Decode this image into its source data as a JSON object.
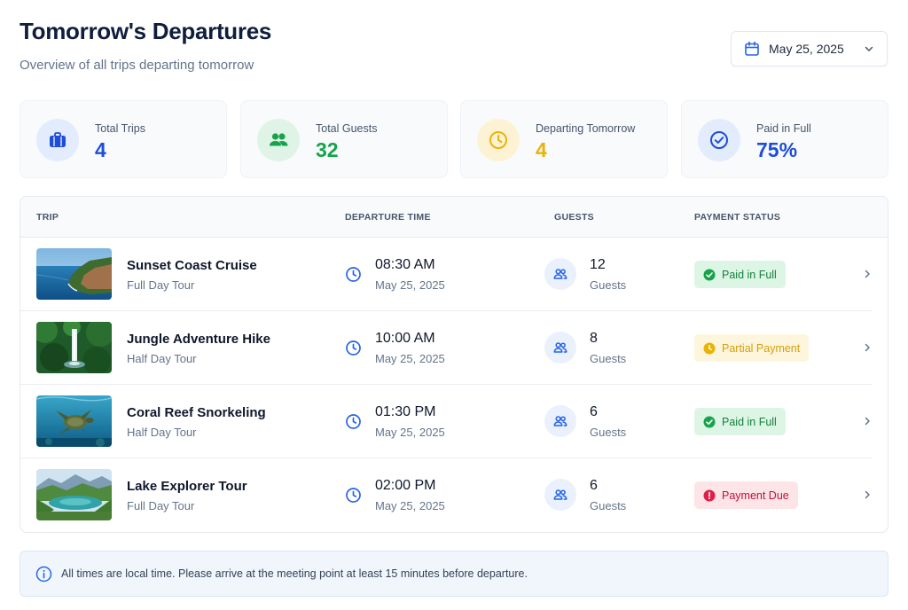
{
  "header": {
    "title": "Tomorrow's Departures",
    "subtitle": "Overview of all trips departing tomorrow",
    "date_picker": {
      "value": "May 25, 2025",
      "icon": "calendar-icon"
    }
  },
  "stats": [
    {
      "label": "Total Trips",
      "value": "4",
      "icon": "suitcase-icon",
      "color": "#1d4ed8",
      "bg": "#e3ecfc"
    },
    {
      "label": "Total Guests",
      "value": "32",
      "icon": "users-icon",
      "color": "#16a34a",
      "bg": "#dff3e6"
    },
    {
      "label": "Departing Tomorrow",
      "value": "4",
      "icon": "clock-icon",
      "color": "#eab308",
      "bg": "#fdf3d4"
    },
    {
      "label": "Paid in Full",
      "value": "75%",
      "icon": "check-circle-icon",
      "color": "#1d4ed8",
      "bg": "#e3ecfc"
    }
  ],
  "table": {
    "headers": {
      "trip": "TRIP",
      "departure": "DEPARTURE TIME",
      "guests": "GUESTS",
      "payment": "PAYMENT STATUS"
    },
    "rows": [
      {
        "name": "Sunset Coast Cruise",
        "type": "Full Day Tour",
        "time": "08:30 AM",
        "date": "May 25, 2025",
        "guests": "12",
        "guests_label": "Guests",
        "status": "Paid in Full",
        "status_kind": "paid",
        "image": "coast-photo"
      },
      {
        "name": "Jungle Adventure Hike",
        "type": "Half Day Tour",
        "time": "10:00 AM",
        "date": "May 25, 2025",
        "guests": "8",
        "guests_label": "Guests",
        "status": "Partial Payment",
        "status_kind": "partial",
        "image": "jungle-waterfall-photo"
      },
      {
        "name": "Coral Reef Snorkeling",
        "type": "Half Day Tour",
        "time": "01:30 PM",
        "date": "May 25, 2025",
        "guests": "6",
        "guests_label": "Guests",
        "status": "Paid in Full",
        "status_kind": "paid",
        "image": "sea-turtle-photo"
      },
      {
        "name": "Lake Explorer Tour",
        "type": "Full Day Tour",
        "time": "02:00 PM",
        "date": "May 25, 2025",
        "guests": "6",
        "guests_label": "Guests",
        "status": "Payment Due",
        "status_kind": "due",
        "image": "lake-photo"
      }
    ]
  },
  "status_colors": {
    "paid": {
      "bg": "#dcf5e4",
      "fg": "#15803d",
      "icon": "#16a34a"
    },
    "partial": {
      "bg": "#fef6dc",
      "fg": "#d4a00a",
      "icon": "#eab308"
    },
    "due": {
      "bg": "#fde4e6",
      "fg": "#be123c",
      "icon": "#e11d48"
    }
  },
  "notice": {
    "text": "All times are local time. Please arrive at the meeting point at least 15 minutes before departure.",
    "icon": "info-icon"
  }
}
